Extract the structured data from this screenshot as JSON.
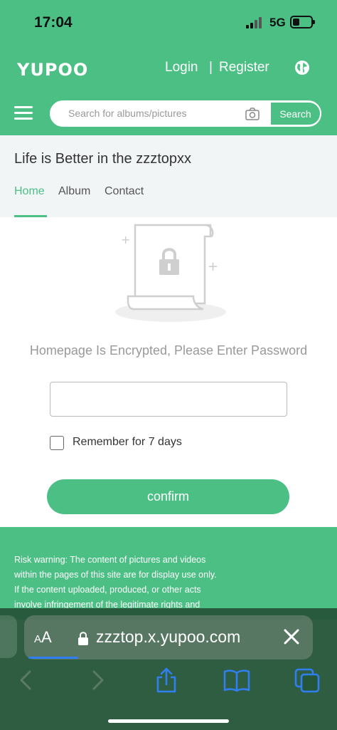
{
  "status_bar": {
    "time": "17:04",
    "network": "5G"
  },
  "header": {
    "logo": "YUPOO",
    "login": "Login",
    "separator": "|",
    "register": "Register",
    "search": {
      "placeholder": "Search for albums/pictures",
      "button": "Search"
    }
  },
  "album_header": {
    "title": "Life is Better in the zzztopxx",
    "tabs": [
      {
        "label": "Home",
        "active": true
      },
      {
        "label": "Album",
        "active": false
      },
      {
        "label": "Contact",
        "active": false
      }
    ]
  },
  "lock_screen": {
    "message": "Homepage Is Encrypted, Please Enter Password",
    "password_value": "",
    "remember_label": "Remember for 7 days",
    "remember_checked": false,
    "confirm_label": "confirm"
  },
  "footer": {
    "risk_lines": [
      "Risk warning: The content of pictures and videos",
      "within the pages of this site are for display use only.",
      "If the content uploaded, produced, or other acts",
      "involve infringement of the legitimate rights and"
    ]
  },
  "browser": {
    "aa_large": "A",
    "aa_small": "A",
    "url": "zzztop.x.yupoo.com"
  },
  "colors": {
    "brand_green": "#4cbf84",
    "browser_bar": "#26563a",
    "progress_blue": "#2f7ff0"
  },
  "icons": [
    "globe-icon",
    "hamburger-menu-icon",
    "camera-icon",
    "lock-icon",
    "close-icon",
    "back-arrow-icon",
    "forward-arrow-icon",
    "share-icon",
    "bookmarks-icon",
    "tabs-icon"
  ]
}
